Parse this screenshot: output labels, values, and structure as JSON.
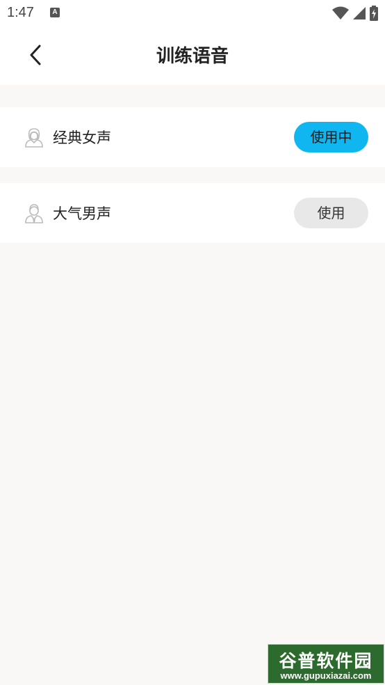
{
  "status_bar": {
    "time": "1:47",
    "notification_icon": "A",
    "icons": [
      "wifi-icon",
      "signal-icon",
      "battery-charging-icon"
    ]
  },
  "header": {
    "back_icon": "chevron-left-icon",
    "title": "训练语音"
  },
  "voices": [
    {
      "label": "经典女声",
      "icon": "female-user-icon",
      "button": "使用中",
      "active": true
    },
    {
      "label": "大气男声",
      "icon": "male-user-icon",
      "button": "使用",
      "active": false
    }
  ],
  "colors": {
    "accent": "#0fb6ef",
    "inactive_button": "#e8e8e8",
    "page_background": "#f9f8f7",
    "watermark_green": "#2d6a2d"
  },
  "watermark": {
    "title": "谷普软件园",
    "url": "www.gupuxiazai.com"
  }
}
